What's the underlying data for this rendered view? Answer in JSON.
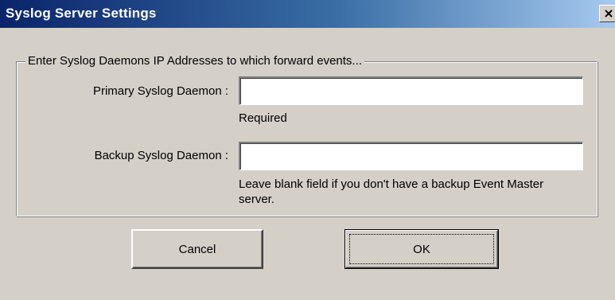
{
  "window": {
    "title": "Syslog Server Settings",
    "close_icon": "close-icon"
  },
  "group": {
    "legend": "Enter Syslog Daemons IP Addresses to which forward events..."
  },
  "primary": {
    "label": "Primary Syslog Daemon :",
    "value": "",
    "hint": "Required"
  },
  "backup": {
    "label": "Backup Syslog Daemon :",
    "value": "",
    "hint": "Leave blank field if you don't have a backup Event Master server."
  },
  "buttons": {
    "cancel_label": "Cancel",
    "ok_label": "OK"
  },
  "colors": {
    "titlebar_start": "#0a246a",
    "titlebar_end": "#a6caf0",
    "face": "#d4d0c8"
  }
}
